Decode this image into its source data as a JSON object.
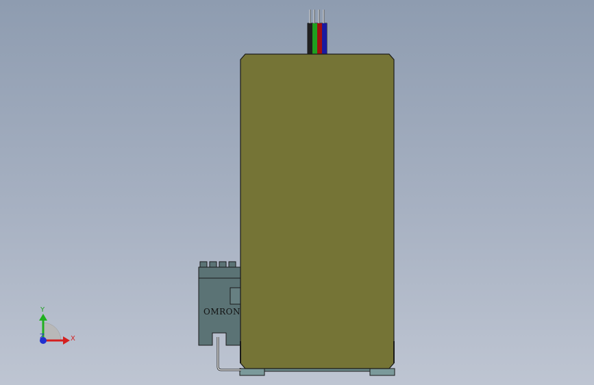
{
  "model": {
    "brand_label": "OMRON",
    "wire_colors": [
      "#202020",
      "#1fa01f",
      "#a01010",
      "#1a1aa0"
    ],
    "body_color": "#757436",
    "module_color": "#5b7375",
    "base_color": "#7b9a9b"
  },
  "triad": {
    "x_label": "X",
    "y_label": "Y",
    "z_label": "Z",
    "x_color": "#d42020",
    "y_color": "#20b020",
    "z_color": "#2030d0"
  }
}
